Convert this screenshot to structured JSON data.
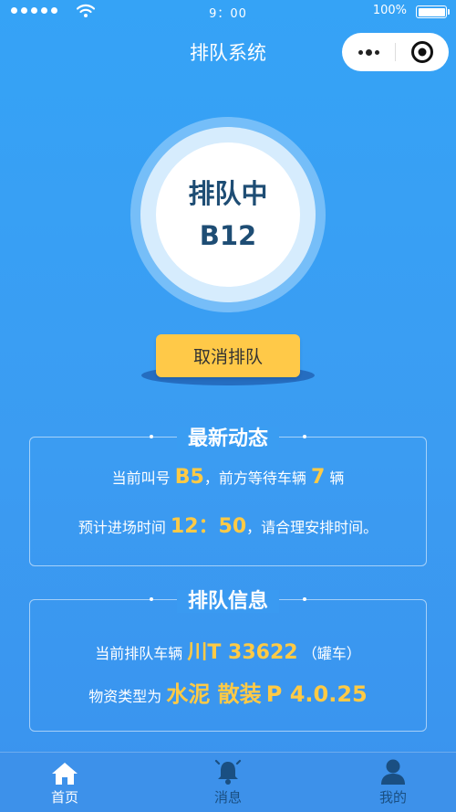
{
  "status_bar": {
    "time": "9：00",
    "battery_percent": "100%",
    "battery_level": 1.0
  },
  "nav": {
    "title": "排队系统"
  },
  "queue": {
    "status": "排队中",
    "number": "B12"
  },
  "cancel_button_label": "取消排队",
  "news": {
    "title": "最新动态",
    "line1": {
      "prefix": "当前叫号",
      "called": "B5",
      "middle": "，前方等待车辆",
      "waiting": "7",
      "suffix": "辆"
    },
    "line2": {
      "prefix": "预计进场时间",
      "time": "12：50",
      "suffix": "，请合理安排时间。"
    }
  },
  "queue_info": {
    "title": "排队信息",
    "line1": {
      "prefix": "当前排队车辆",
      "plate": "川T 33622",
      "suffix": "（罐车）"
    },
    "line2": {
      "prefix": "物资类型为",
      "material": "水泥 散装",
      "spec": "P 4.0.25"
    }
  },
  "tabs": [
    {
      "label": "首页",
      "icon": "home-icon",
      "active": true
    },
    {
      "label": "消息",
      "icon": "bell-icon",
      "active": false
    },
    {
      "label": "我的",
      "icon": "user-icon",
      "active": false
    }
  ],
  "colors": {
    "background": "#3a9cf2",
    "highlight": "#ffca45",
    "button": "#ffc948",
    "tab_inactive": "#1a4f82"
  }
}
